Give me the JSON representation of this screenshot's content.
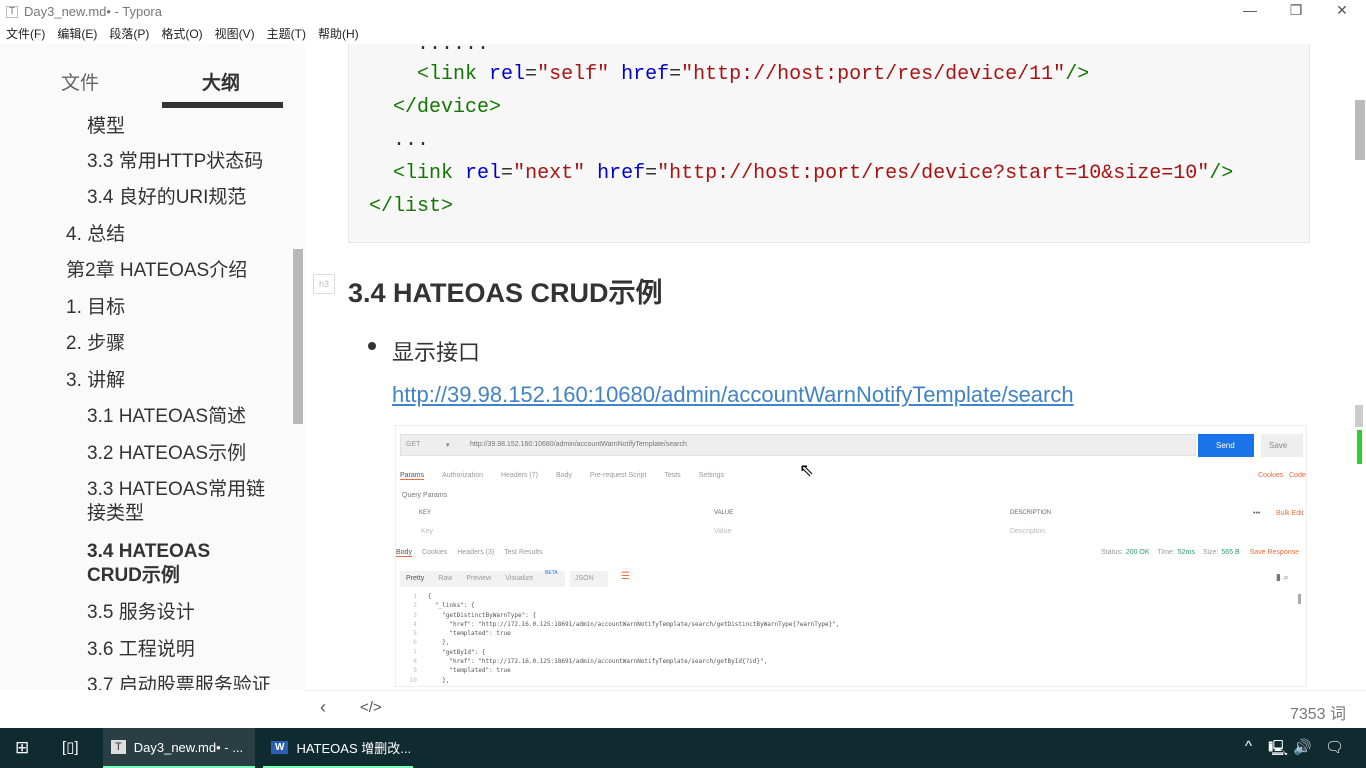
{
  "window": {
    "title": "Day3_new.md• - Typora",
    "app_icon": "T",
    "controls": [
      "minimize",
      "restore",
      "close"
    ]
  },
  "menu": [
    "文件(F)",
    "编辑(E)",
    "段落(P)",
    "格式(O)",
    "视图(V)",
    "主题(T)",
    "帮助(H)"
  ],
  "sidebar": {
    "tabs": [
      "文件",
      "大纲"
    ],
    "active_tab": "大纲",
    "outline": [
      "模型",
      "3.3 常用HTTP状态码",
      "3.4 良好的URI规范",
      "4. 总结",
      "第2章 HATEOAS介绍",
      "1. 目标",
      "2. 步骤",
      "3. 讲解",
      "3.1 HATEOAS简述",
      "3.2 HATEOAS示例",
      "3.3 HATEOAS常用链接类型",
      "3.4 HATEOAS CRUD示例",
      "3.5 服务设计",
      "3.6 工程说明",
      "3.7 启动股票服务验证"
    ],
    "active_item": "3.4 HATEOAS CRUD示例"
  },
  "code": {
    "line1": "......",
    "l2_tag": "<link",
    "l2_a1": "rel",
    "l2_v1": "\"self\"",
    "l2_a2": "href",
    "l2_v2": "\"http://host:port/res/device/11\"",
    "l2_end": "/>",
    "line3": "</device>",
    "line4": "...",
    "l5_tag": "<link",
    "l5_a1": "rel",
    "l5_v1": "\"next\"",
    "l5_a2": "href",
    "l5_v2": "\"http://host:port/res/device?start=10&size=10\"",
    "l5_end": "/>",
    "line6": "</list>"
  },
  "heading": "3.4 HATEOAS CRUD示例",
  "bullet": "显示接口",
  "link": "http://39.98.152.160:10680/admin/accountWarnNotifyTemplate/search",
  "postman": {
    "method": "GET",
    "url": "http://39.98.152.160:10680/admin/accountWarnNotifyTemplate/search",
    "send": "Send",
    "save": "Save",
    "req_tabs": [
      "Params",
      "Authorization",
      "Headers (7)",
      "Body",
      "Pre-request Script",
      "Tests",
      "Settings"
    ],
    "cookies": "Cookies",
    "code": "Code",
    "query_params": "Query Params",
    "cols": [
      "KEY",
      "VALUE",
      "DESCRIPTION"
    ],
    "placeholders": [
      "Key",
      "Value",
      "Description"
    ],
    "bulk_edit": "Bulk Edit",
    "res_tabs": [
      "Body",
      "Cookies",
      "Headers (3)",
      "Test Results"
    ],
    "status_label": "Status:",
    "status": "200 OK",
    "time_label": "Time:",
    "time": "52ms",
    "size_label": "Size:",
    "size": "565 B",
    "save_response": "Save Response",
    "view_tabs": [
      "Pretty",
      "Raw",
      "Preview",
      "Visualize"
    ],
    "beta": "BETA",
    "format": "JSON",
    "lines": [
      "{",
      "  \"_links\": {",
      "    \"getDistinctByWarnType\": {",
      "      \"href\": \"http://172.16.0.125:18691/admin/accountWarnNotifyTemplate/search/getDistinctByWarnType{?warnType}\",",
      "      \"templated\": true",
      "    },",
      "    \"getById\": {",
      "      \"href\": \"http://172.16.0.125:18691/admin/accountWarnNotifyTemplate/search/getById{?id}\",",
      "      \"templated\": true",
      "    },"
    ]
  },
  "footer": {
    "word_count": "7353 词"
  },
  "taskbar": {
    "apps": [
      "Day3_new.md• - ...",
      "HATEOAS 增删改..."
    ]
  }
}
